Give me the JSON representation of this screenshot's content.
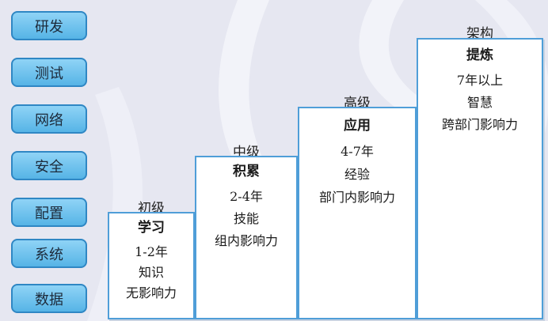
{
  "sidebar": {
    "items": [
      {
        "label": "研发"
      },
      {
        "label": "测试"
      },
      {
        "label": "网络"
      },
      {
        "label": "安全"
      },
      {
        "label": "配置"
      },
      {
        "label": "系统"
      },
      {
        "label": "数据"
      }
    ]
  },
  "levels": [
    {
      "title": "初级",
      "keyword": "学习",
      "years": "1-2年",
      "trait": "知识",
      "influence": "无影响力"
    },
    {
      "title": "中级",
      "keyword": "积累",
      "years": "2-4年",
      "trait": "技能",
      "influence": "组内影响力"
    },
    {
      "title": "高级",
      "keyword": "应用",
      "years": "4-7年",
      "trait": "经验",
      "influence": "部门内影响力"
    },
    {
      "title": "架构",
      "keyword": "提炼",
      "years": "7年以上",
      "trait": "智慧",
      "influence": "跨部门影响力"
    }
  ],
  "colors": {
    "button_fill": "#62bdea",
    "button_border": "#2f87c4",
    "step_border": "#4f9ed8",
    "background": "#e6e7f1"
  }
}
